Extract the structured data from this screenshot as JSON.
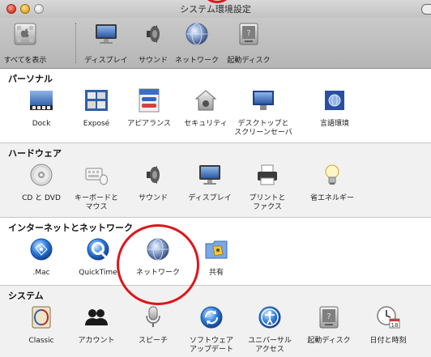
{
  "window": {
    "title": "システム環境設定"
  },
  "toolbar": {
    "items": [
      {
        "label": "すべてを表示",
        "icon": "apple-grid-icon"
      },
      {
        "label": "ディスプレイ",
        "icon": "display-icon"
      },
      {
        "label": "サウンド",
        "icon": "speaker-icon"
      },
      {
        "label": "ネットワーク",
        "icon": "network-globe-icon"
      },
      {
        "label": "起動ディスク",
        "icon": "startup-disk-icon"
      }
    ]
  },
  "sections": [
    {
      "title": "パーソナル",
      "items": [
        {
          "label": "Dock",
          "icon": "dock-icon"
        },
        {
          "label": "Exposé",
          "icon": "expose-icon"
        },
        {
          "label": "アピアランス",
          "icon": "appearance-icon"
        },
        {
          "label": "セキュリティ",
          "icon": "security-house-icon"
        },
        {
          "label": "デスクトップと\nスクリーンセーバ",
          "icon": "desktop-icon"
        },
        {
          "label": "言語環境",
          "icon": "international-flag-icon"
        }
      ]
    },
    {
      "title": "ハードウェア",
      "items": [
        {
          "label": "CD と DVD",
          "icon": "cd-icon"
        },
        {
          "label": "キーボードと\nマウス",
          "icon": "keyboard-mouse-icon"
        },
        {
          "label": "サウンド",
          "icon": "speaker-icon"
        },
        {
          "label": "ディスプレイ",
          "icon": "display-icon"
        },
        {
          "label": "プリントと\nファクス",
          "icon": "printer-icon"
        },
        {
          "label": "省エネルギー",
          "icon": "lightbulb-icon"
        }
      ]
    },
    {
      "title": "インターネットとネットワーク",
      "items": [
        {
          "label": ".Mac",
          "icon": "dotmac-globe-icon"
        },
        {
          "label": "QuickTime",
          "icon": "quicktime-icon"
        },
        {
          "label": "ネットワーク",
          "icon": "network-globe-icon"
        },
        {
          "label": "共有",
          "icon": "sharing-folder-icon"
        }
      ]
    },
    {
      "title": "システム",
      "items": [
        {
          "label": "Classic",
          "icon": "classic-icon"
        },
        {
          "label": "アカウント",
          "icon": "accounts-icon"
        },
        {
          "label": "スピーチ",
          "icon": "microphone-icon"
        },
        {
          "label": "ソフトウェア\nアップデート",
          "icon": "software-update-icon"
        },
        {
          "label": "ユニバーサル\nアクセス",
          "icon": "universal-access-icon"
        },
        {
          "label": "起動ディスク",
          "icon": "startup-disk-icon"
        },
        {
          "label": "日付と時刻",
          "icon": "clock-icon"
        }
      ]
    }
  ],
  "colors": {
    "annotation": "#e0141a",
    "aqua_blue": "#2f66c8"
  }
}
